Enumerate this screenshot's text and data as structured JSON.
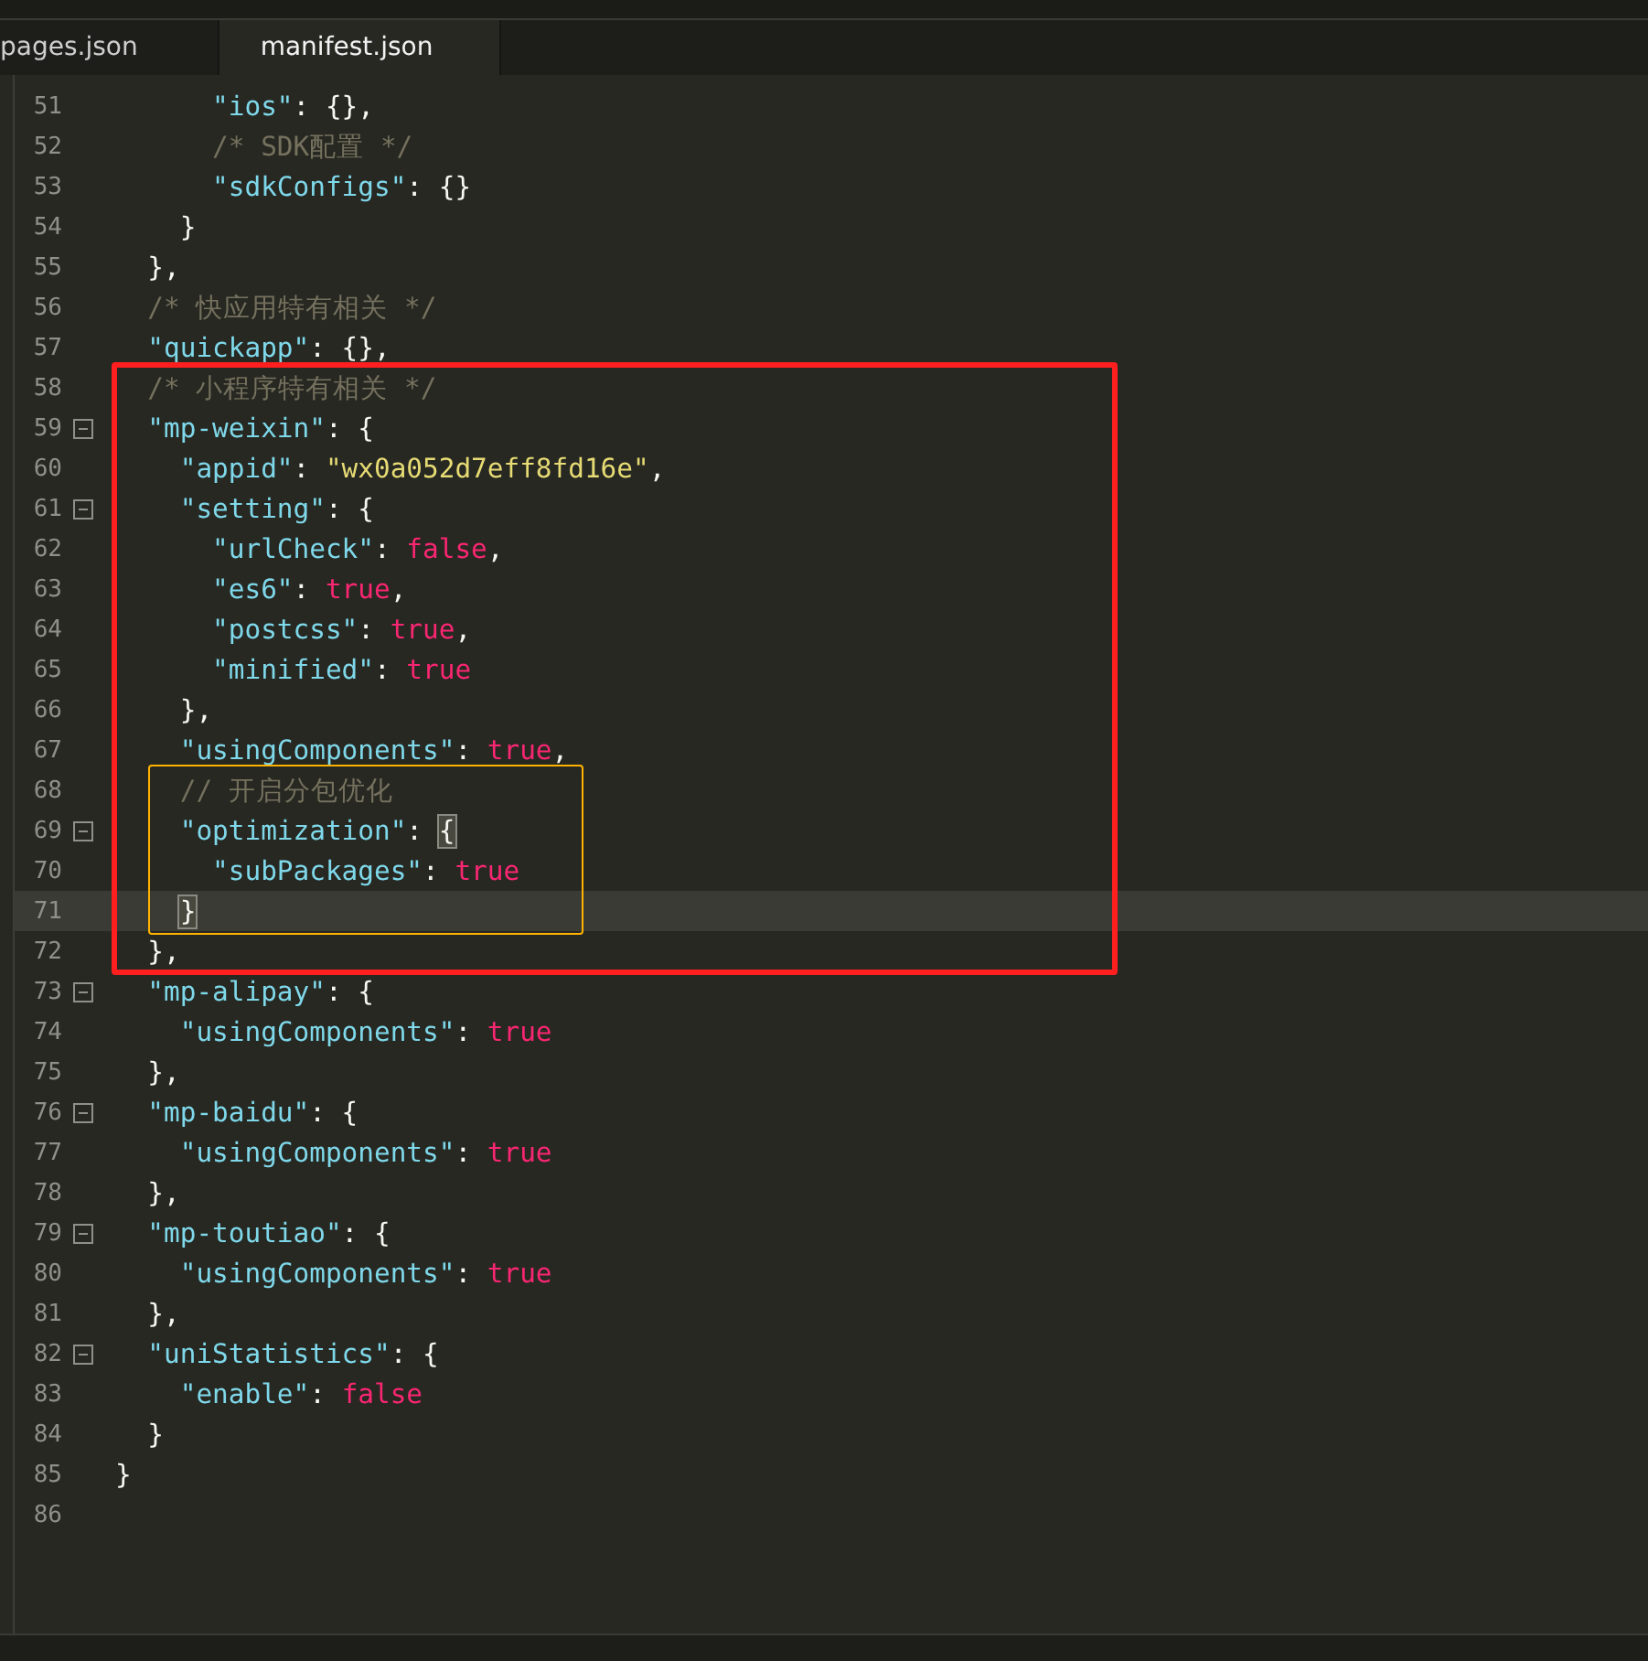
{
  "tabs": [
    {
      "label": "pages.json",
      "selected": false
    },
    {
      "label": "manifest.json",
      "selected": true
    }
  ],
  "editor": {
    "blocks": [
      {
        "kind": "lines",
        "lines": [
          {
            "number": "51",
            "fold": false,
            "current": false,
            "tokens": [
              {
                "kind": "key",
                "text": "      \"ios\""
              },
              {
                "kind": "punct",
                "text": ": {},"
              }
            ]
          },
          {
            "number": "52",
            "fold": false,
            "current": false,
            "tokens": [
              {
                "kind": "comment",
                "text": "      /* SDK配置 */"
              }
            ]
          },
          {
            "number": "53",
            "fold": false,
            "current": false,
            "tokens": [
              {
                "kind": "key",
                "text": "      \"sdkConfigs\""
              },
              {
                "kind": "punct",
                "text": ": {}"
              }
            ]
          },
          {
            "number": "54",
            "fold": false,
            "current": false,
            "tokens": [
              {
                "kind": "punct",
                "text": "    }"
              }
            ]
          },
          {
            "number": "55",
            "fold": false,
            "current": false,
            "tokens": [
              {
                "kind": "punct",
                "text": "  },"
              }
            ]
          },
          {
            "number": "56",
            "fold": false,
            "current": false,
            "tokens": [
              {
                "kind": "comment",
                "text": "  /* 快应用特有相关 */"
              }
            ]
          },
          {
            "number": "57",
            "fold": false,
            "current": false,
            "tokens": [
              {
                "kind": "key",
                "text": "  \"quickapp\""
              },
              {
                "kind": "punct",
                "text": ": {},"
              }
            ]
          }
        ]
      },
      {
        "kind": "annotation",
        "color": "#ff1f1f",
        "blocks": [
          {
            "kind": "lines",
            "lines": [
              {
                "number": "58",
                "fold": false,
                "current": false,
                "tokens": [
                  {
                    "kind": "comment",
                    "text": "  /* 小程序特有相关 */"
                  }
                ]
              },
              {
                "number": "59",
                "fold": true,
                "current": false,
                "tokens": [
                  {
                    "kind": "key",
                    "text": "  \"mp-weixin\""
                  },
                  {
                    "kind": "punct",
                    "text": ": {"
                  }
                ]
              },
              {
                "number": "60",
                "fold": false,
                "current": false,
                "tokens": [
                  {
                    "kind": "key",
                    "text": "    \"appid\""
                  },
                  {
                    "kind": "punct",
                    "text": ": "
                  },
                  {
                    "kind": "string",
                    "text": "\"wx0a052d7eff8fd16e\""
                  },
                  {
                    "kind": "punct",
                    "text": ","
                  }
                ]
              },
              {
                "number": "61",
                "fold": true,
                "current": false,
                "tokens": [
                  {
                    "kind": "key",
                    "text": "    \"setting\""
                  },
                  {
                    "kind": "punct",
                    "text": ": {"
                  }
                ]
              },
              {
                "number": "62",
                "fold": false,
                "current": false,
                "tokens": [
                  {
                    "kind": "key",
                    "text": "      \"urlCheck\""
                  },
                  {
                    "kind": "punct",
                    "text": ": "
                  },
                  {
                    "kind": "bool",
                    "text": "false"
                  },
                  {
                    "kind": "punct",
                    "text": ","
                  }
                ]
              },
              {
                "number": "63",
                "fold": false,
                "current": false,
                "tokens": [
                  {
                    "kind": "key",
                    "text": "      \"es6\""
                  },
                  {
                    "kind": "punct",
                    "text": ": "
                  },
                  {
                    "kind": "bool",
                    "text": "true"
                  },
                  {
                    "kind": "punct",
                    "text": ","
                  }
                ]
              },
              {
                "number": "64",
                "fold": false,
                "current": false,
                "tokens": [
                  {
                    "kind": "key",
                    "text": "      \"postcss\""
                  },
                  {
                    "kind": "punct",
                    "text": ": "
                  },
                  {
                    "kind": "bool",
                    "text": "true"
                  },
                  {
                    "kind": "punct",
                    "text": ","
                  }
                ]
              },
              {
                "number": "65",
                "fold": false,
                "current": false,
                "tokens": [
                  {
                    "kind": "key",
                    "text": "      \"minified\""
                  },
                  {
                    "kind": "punct",
                    "text": ": "
                  },
                  {
                    "kind": "bool",
                    "text": "true"
                  }
                ]
              },
              {
                "number": "66",
                "fold": false,
                "current": false,
                "tokens": [
                  {
                    "kind": "punct",
                    "text": "    },"
                  }
                ]
              },
              {
                "number": "67",
                "fold": false,
                "current": false,
                "tokens": [
                  {
                    "kind": "key",
                    "text": "    \"usingComponents\""
                  },
                  {
                    "kind": "punct",
                    "text": ": "
                  },
                  {
                    "kind": "bool",
                    "text": "true"
                  },
                  {
                    "kind": "punct",
                    "text": ","
                  }
                ]
              }
            ]
          },
          {
            "kind": "annotation",
            "color": "#ffb300",
            "blocks": [
              {
                "kind": "lines",
                "lines": [
                  {
                    "number": "68",
                    "fold": false,
                    "current": false,
                    "tokens": [
                      {
                        "kind": "comment",
                        "text": "    // 开启分包优化"
                      }
                    ]
                  },
                  {
                    "number": "69",
                    "fold": true,
                    "current": false,
                    "tokens": [
                      {
                        "kind": "key",
                        "text": "    \"optimization\""
                      },
                      {
                        "kind": "punct",
                        "text": ": "
                      },
                      {
                        "kind": "bracket",
                        "text": "{"
                      }
                    ]
                  },
                  {
                    "number": "70",
                    "fold": false,
                    "current": false,
                    "tokens": [
                      {
                        "kind": "key",
                        "text": "      \"subPackages\""
                      },
                      {
                        "kind": "punct",
                        "text": ": "
                      },
                      {
                        "kind": "bool",
                        "text": "true"
                      }
                    ]
                  },
                  {
                    "number": "71",
                    "fold": false,
                    "current": true,
                    "tokens": [
                      {
                        "kind": "bracket",
                        "text": "    }"
                      }
                    ]
                  }
                ]
              }
            ]
          },
          {
            "kind": "lines",
            "lines": [
              {
                "number": "72",
                "fold": false,
                "current": false,
                "tokens": [
                  {
                    "kind": "punct",
                    "text": "  },"
                  }
                ]
              }
            ]
          }
        ]
      },
      {
        "kind": "lines",
        "lines": [
          {
            "number": "73",
            "fold": true,
            "current": false,
            "tokens": [
              {
                "kind": "key",
                "text": "  \"mp-alipay\""
              },
              {
                "kind": "punct",
                "text": ": {"
              }
            ]
          },
          {
            "number": "74",
            "fold": false,
            "current": false,
            "tokens": [
              {
                "kind": "key",
                "text": "    \"usingComponents\""
              },
              {
                "kind": "punct",
                "text": ": "
              },
              {
                "kind": "bool",
                "text": "true"
              }
            ]
          },
          {
            "number": "75",
            "fold": false,
            "current": false,
            "tokens": [
              {
                "kind": "punct",
                "text": "  },"
              }
            ]
          },
          {
            "number": "76",
            "fold": true,
            "current": false,
            "tokens": [
              {
                "kind": "key",
                "text": "  \"mp-baidu\""
              },
              {
                "kind": "punct",
                "text": ": {"
              }
            ]
          },
          {
            "number": "77",
            "fold": false,
            "current": false,
            "tokens": [
              {
                "kind": "key",
                "text": "    \"usingComponents\""
              },
              {
                "kind": "punct",
                "text": ": "
              },
              {
                "kind": "bool",
                "text": "true"
              }
            ]
          },
          {
            "number": "78",
            "fold": false,
            "current": false,
            "tokens": [
              {
                "kind": "punct",
                "text": "  },"
              }
            ]
          },
          {
            "number": "79",
            "fold": true,
            "current": false,
            "tokens": [
              {
                "kind": "key",
                "text": "  \"mp-toutiao\""
              },
              {
                "kind": "punct",
                "text": ": {"
              }
            ]
          },
          {
            "number": "80",
            "fold": false,
            "current": false,
            "tokens": [
              {
                "kind": "key",
                "text": "    \"usingComponents\""
              },
              {
                "kind": "punct",
                "text": ": "
              },
              {
                "kind": "bool",
                "text": "true"
              }
            ]
          },
          {
            "number": "81",
            "fold": false,
            "current": false,
            "tokens": [
              {
                "kind": "punct",
                "text": "  },"
              }
            ]
          },
          {
            "number": "82",
            "fold": true,
            "current": false,
            "tokens": [
              {
                "kind": "key",
                "text": "  \"uniStatistics\""
              },
              {
                "kind": "punct",
                "text": ": {"
              }
            ]
          },
          {
            "number": "83",
            "fold": false,
            "current": false,
            "tokens": [
              {
                "kind": "key",
                "text": "    \"enable\""
              },
              {
                "kind": "punct",
                "text": ": "
              },
              {
                "kind": "bool",
                "text": "false"
              }
            ]
          },
          {
            "number": "84",
            "fold": false,
            "current": false,
            "tokens": [
              {
                "kind": "punct",
                "text": "  }"
              }
            ]
          },
          {
            "number": "85",
            "fold": false,
            "current": false,
            "tokens": [
              {
                "kind": "punct",
                "text": "}"
              }
            ]
          },
          {
            "number": "86",
            "fold": false,
            "current": false
          }
        ]
      }
    ]
  }
}
